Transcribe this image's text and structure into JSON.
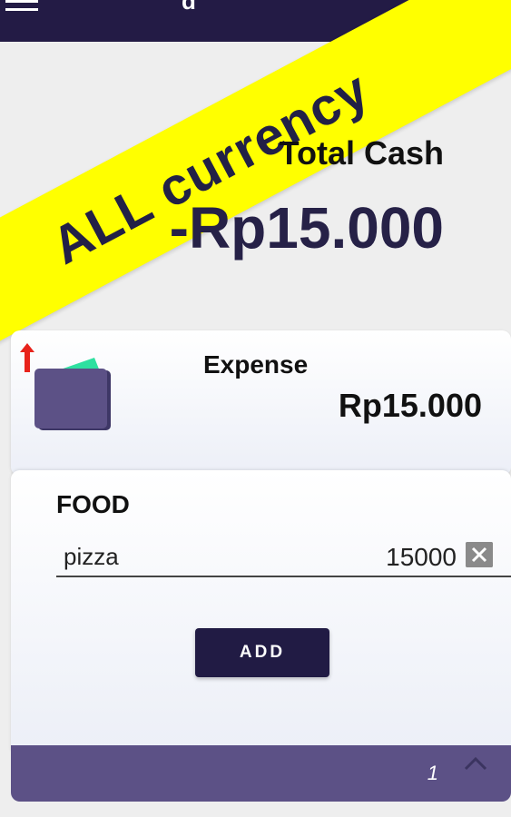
{
  "header": {
    "title": "d",
    "menu_icon": "hamburger-menu-icon",
    "background": "#231b45"
  },
  "banner": {
    "text": "ALL currency",
    "color": "#ffff00"
  },
  "summary": {
    "total_label": "Total Cash",
    "total_value": "-Rp15.000"
  },
  "expense": {
    "label": "Expense",
    "amount": "Rp15.000",
    "icons": [
      "up-arrow-icon",
      "wallet-icon"
    ]
  },
  "category": {
    "title": "FOOD",
    "items": [
      {
        "name": "pizza",
        "amount": "15000"
      }
    ],
    "add_label": "ADD"
  },
  "footer": {
    "page_count": "1",
    "chevron_icon": "chevron-up-icon"
  }
}
